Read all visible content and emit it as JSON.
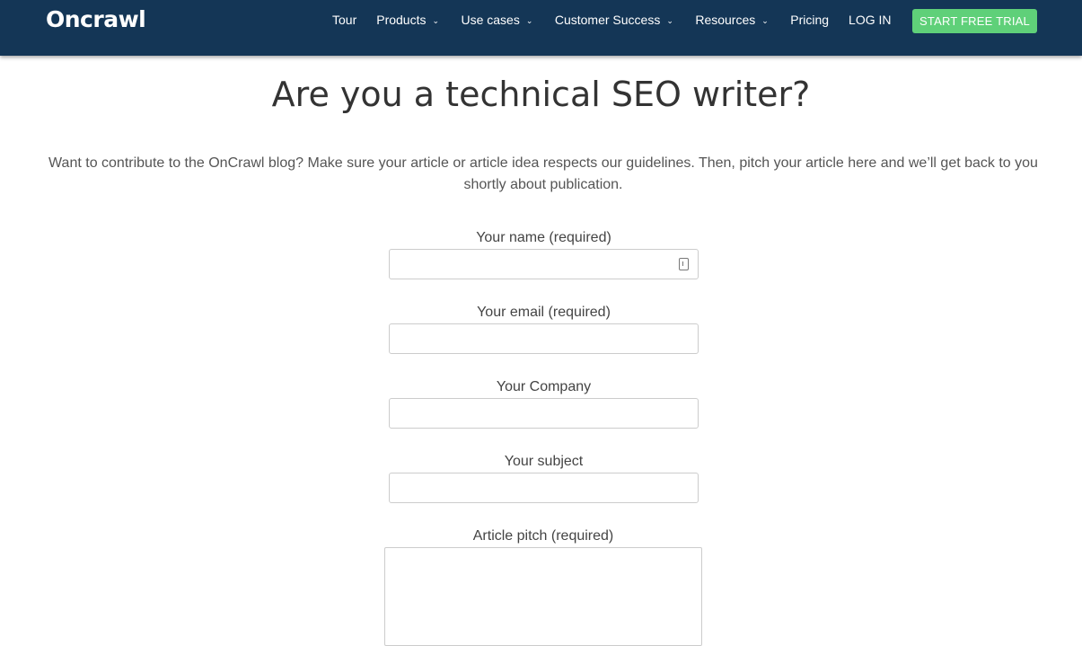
{
  "brand": {
    "logo_text": "Oncrawl"
  },
  "nav": {
    "items": [
      {
        "label": "Tour",
        "has_dropdown": false
      },
      {
        "label": "Products",
        "has_dropdown": true
      },
      {
        "label": "Use cases",
        "has_dropdown": true
      },
      {
        "label": "Customer Success",
        "has_dropdown": true
      },
      {
        "label": "Resources",
        "has_dropdown": true
      },
      {
        "label": "Pricing",
        "has_dropdown": false
      },
      {
        "label": "LOG IN",
        "has_dropdown": false
      }
    ],
    "cta_label": "START FREE TRIAL",
    "chevron_icon": "chevron-down-icon"
  },
  "page": {
    "title": "Are you a technical SEO writer?",
    "intro": "Want to contribute to the OnCrawl blog? Make sure your article or article idea respects our guidelines. Then, pitch your article here and we’ll get back to you shortly about publication."
  },
  "form": {
    "name_label": "Your name (required)",
    "name_value": "",
    "name_icon": "contact-card-icon",
    "email_label": "Your email (required)",
    "email_value": "",
    "company_label": "Your Company",
    "company_value": "",
    "subject_label": "Your subject",
    "subject_value": "",
    "pitch_label": "Article pitch (required)",
    "pitch_value": ""
  },
  "colors": {
    "navbar_bg": "#143656",
    "cta_bg": "#5fd079",
    "title_text": "#333333",
    "body_text": "#555555"
  }
}
